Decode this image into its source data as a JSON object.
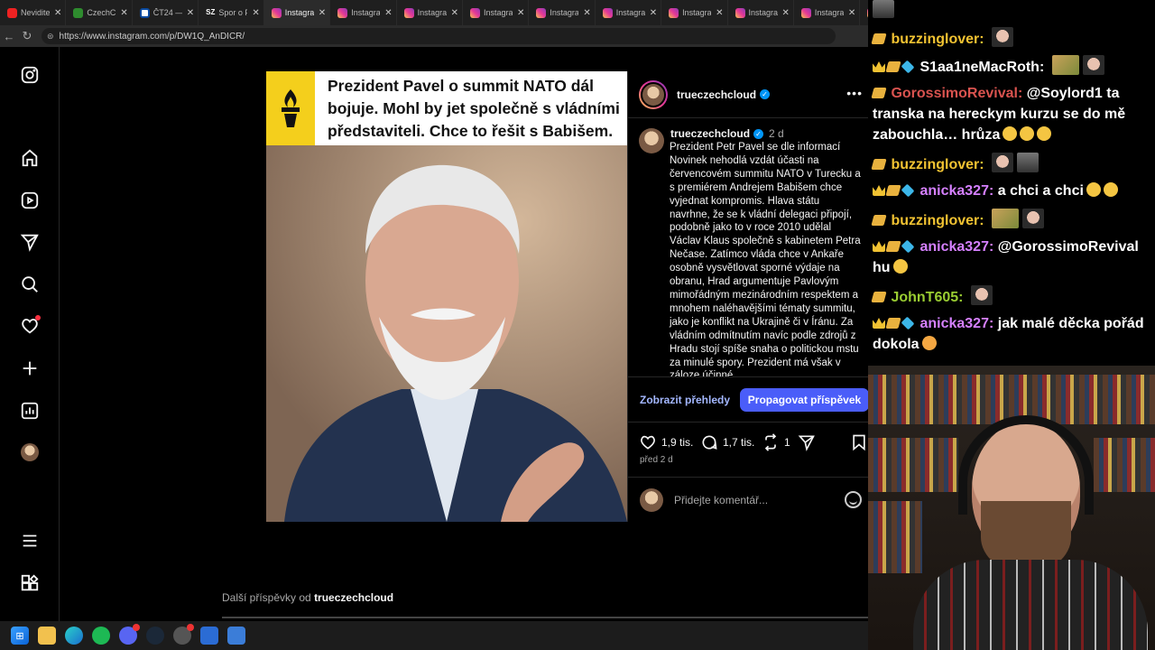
{
  "browser": {
    "tabs": [
      {
        "title": "Neviditel",
        "favicon": "youtube-icon",
        "active": false
      },
      {
        "title": "CzechC",
        "favicon": "czechcloud-icon",
        "active": false
      },
      {
        "title": "ČT24 —",
        "favicon": "ct24-icon",
        "active": false
      },
      {
        "title": "Spor o P",
        "favicon": "sz-icon",
        "active": false
      },
      {
        "title": "Instagra",
        "favicon": "instagram-icon",
        "active": true
      },
      {
        "title": "Instagra",
        "favicon": "instagram-icon",
        "active": false
      },
      {
        "title": "Instagra",
        "favicon": "instagram-icon",
        "active": false
      },
      {
        "title": "Instagra",
        "favicon": "instagram-icon",
        "active": false
      },
      {
        "title": "Instagra",
        "favicon": "instagram-icon",
        "active": false
      },
      {
        "title": "Instagra",
        "favicon": "instagram-icon",
        "active": false
      },
      {
        "title": "Instagra",
        "favicon": "instagram-icon",
        "active": false
      },
      {
        "title": "Instagra",
        "favicon": "instagram-icon",
        "active": false
      },
      {
        "title": "Instagra",
        "favicon": "instagram-icon",
        "active": false
      },
      {
        "title": "Instagra",
        "favicon": "instagram-icon",
        "active": false
      },
      {
        "title": "Instagra",
        "favicon": "instagram-icon",
        "active": false
      }
    ],
    "sz_label": "SZ",
    "url": "https://www.instagram.com/p/DW1Q_AnDICR/"
  },
  "post": {
    "headline": "Prezident Pavel o summit NATO dál bojuje. Mohl by jet společně s vládními představiteli. Chce to řešit s Babišem.",
    "username": "trueczechcloud",
    "caption_time": "2 d",
    "caption": "Prezident Petr Pavel se dle informací Novinek nehodlá vzdát účasti na červencovém summitu NATO v Turecku a s premiérem Andrejem Babišem chce vyjednat kompromis. Hlava státu navrhne, že se k vládní delegaci připojí, podobně jako to v roce 2010 udělal Václav Klaus společně s kabinetem Petra Nečase. Zatímco vláda chce v Ankaře osobně vysvětlovat sporné výdaje na obranu, Hrad argumentuje Pavlovým mimořádným mezinárodním respektem a mnohem naléhavějšími tématy summitu, jako je konflikt na Ukrajině či v Íránu. Za vládním odmítnutím navíc podle zdrojů z Hradu stojí spíše snaha o politickou mstu za minulé spory. Prezident má však v záloze účinné",
    "view_insights": "Zobrazit přehledy",
    "promote": "Propagovat příspěvek",
    "likes": "1,9 tis.",
    "comments": "1,7 tis.",
    "reposts": "1",
    "date": "před 2 d",
    "comment_placeholder": "Přidejte komentář...",
    "more_posts_prefix": "Další příspěvky od",
    "more_posts_user": "trueczechcloud"
  },
  "chat": {
    "messages": [
      {
        "user": "buzzinglover:",
        "color": "#f1c232",
        "text": ""
      },
      {
        "user": "S1aa1neMacRoth:",
        "color": "#ffffff",
        "text": ""
      },
      {
        "user": "GorossimoRevival:",
        "color": "#d9534f",
        "text": " @Soylord1 ta transka na hereckym kurzu se do mě zabouchla… hrůza"
      },
      {
        "user": "buzzinglover:",
        "color": "#f1c232",
        "text": ""
      },
      {
        "user": "anicka327:",
        "color": "#d580ff",
        "text": " a chci a chci"
      },
      {
        "user": "buzzinglover:",
        "color": "#f1c232",
        "text": ""
      },
      {
        "user": "anicka327:",
        "color": "#d580ff",
        "text": " @GorossimoRevival hu"
      },
      {
        "user": "JohnT605:",
        "color": "#9acd32",
        "text": ""
      },
      {
        "user": "anicka327:",
        "color": "#d580ff",
        "text": " jak malé děcka pořád dokola"
      }
    ]
  },
  "taskbar": {
    "discord_count": "34"
  },
  "colors": {
    "accent": "#4a5df9",
    "verified": "#0095f6",
    "headline_band": "#f4cf1c"
  }
}
